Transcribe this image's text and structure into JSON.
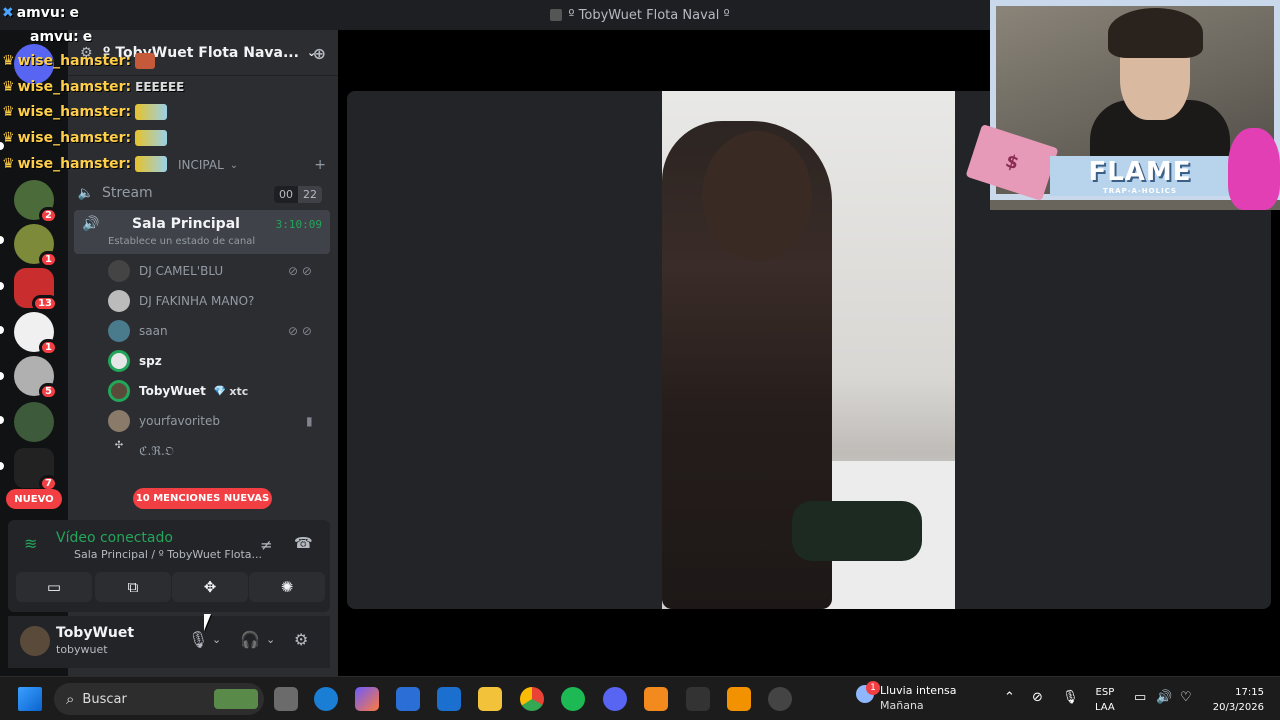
{
  "window": {
    "title": "º TobyWuet Flota Naval º"
  },
  "chat_overlay": {
    "lines": [
      {
        "user": "amvu:",
        "msg": "e"
      },
      {
        "user": "amvu:",
        "msg": "e"
      },
      {
        "user": "wise_hamster:",
        "msg": ""
      },
      {
        "user": "wise_hamster:",
        "msg": ""
      },
      {
        "user": "wise_hamster:",
        "msg": ""
      },
      {
        "user": "wise_hamster:",
        "msg": ""
      },
      {
        "user": "wise_hamster:",
        "msg": ""
      }
    ],
    "fragment": "EEEEEE"
  },
  "server": {
    "name": "º TobyWuet Flota Nava...",
    "category": "INCIPAL"
  },
  "rail": {
    "badges": [
      "2",
      "1",
      "13",
      "1",
      "5",
      "7"
    ],
    "new_label": "NUEVO"
  },
  "channels": {
    "stream": {
      "name": "Stream",
      "count_a": "00",
      "count_b": "22"
    },
    "sala": {
      "name": "Sala Principal",
      "time": "3:10:09",
      "status": "Establece un estado de canal"
    },
    "users": [
      {
        "name": "DJ CAMEL'BLU"
      },
      {
        "name": "DJ FAKINHA MANO?"
      },
      {
        "name": "saan"
      },
      {
        "name": "spz"
      },
      {
        "name": "TobyWuet",
        "tag": "xtc"
      },
      {
        "name": "yourfavoriteb"
      },
      {
        "name": "ℭ.ℜ.𝔒"
      }
    ],
    "mentions": "10 MENCIONES NUEVAS"
  },
  "voice": {
    "status": "Vídeo conectado",
    "sub": "Sala Principal / º TobyWuet Flota..."
  },
  "account": {
    "name": "TobyWuet",
    "handle": "tobywuet"
  },
  "overlay_art": {
    "flame": "FLAME",
    "flame_sub": "TRAP-A-HOLICS"
  },
  "taskbar": {
    "search_placeholder": "Buscar",
    "weather": {
      "condition": "Lluvia intensa",
      "forecast": "Mañana",
      "badge": "1"
    },
    "lang": {
      "a": "ESP",
      "b": "LAA"
    },
    "time": "17:15",
    "date": "20/3/2026"
  },
  "colors": {
    "accent_green": "#23a55a",
    "alert_red": "#f23f43",
    "sidebar": "#2b2d31"
  }
}
